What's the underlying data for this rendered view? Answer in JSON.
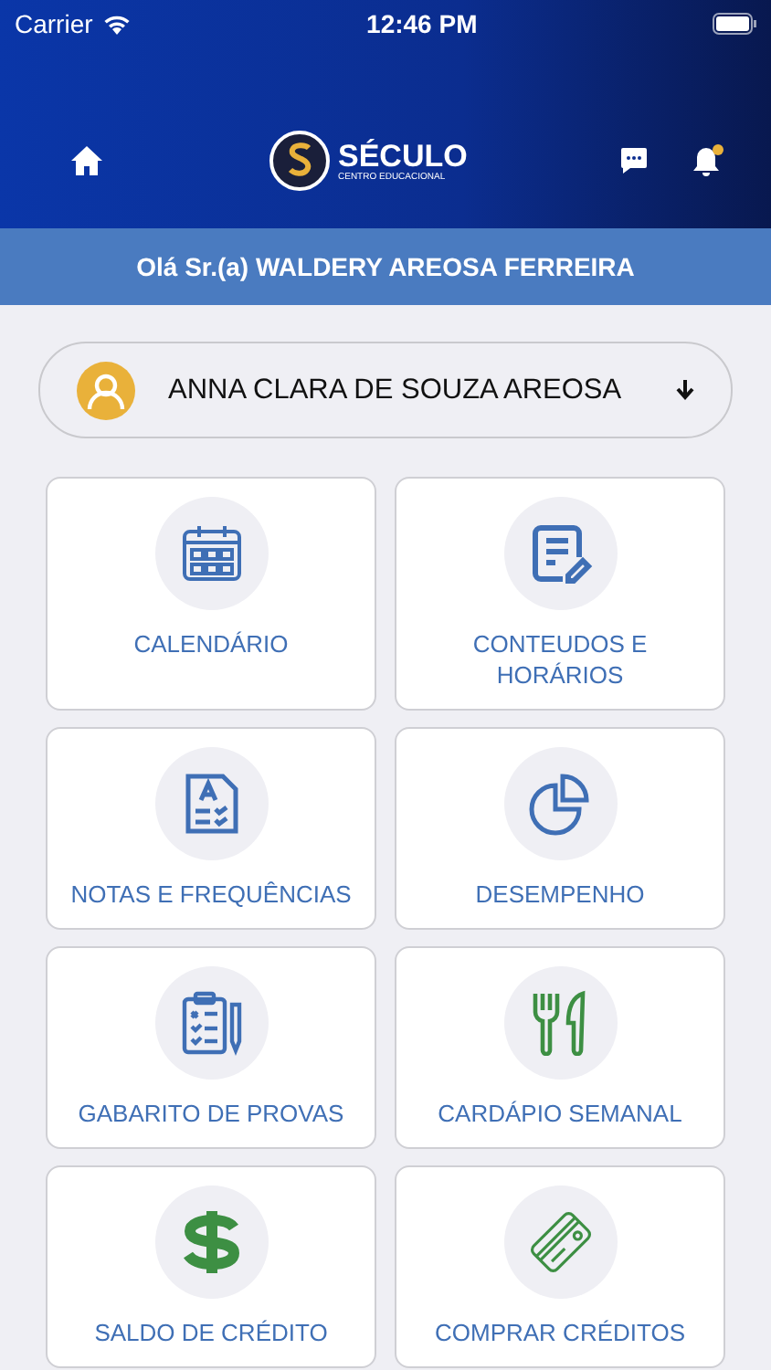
{
  "status_bar": {
    "carrier": "Carrier",
    "time": "12:46 PM"
  },
  "header": {
    "logo_title": "SÉCULO",
    "logo_subtitle": "CENTRO EDUCACIONAL",
    "notification_badge": true
  },
  "greeting": "Olá Sr.(a) WALDERY AREOSA FERREIRA",
  "student_selector": {
    "value": "ANNA CLARA DE SOUZA AREOSA"
  },
  "menu": [
    {
      "kind": "calendar",
      "label": "CALENDÁRIO"
    },
    {
      "kind": "document",
      "label": "CONTEUDOS E HORÁRIOS"
    },
    {
      "kind": "grades",
      "label": "NOTAS E FREQUÊNCIAS"
    },
    {
      "kind": "chart",
      "label": "DESEMPENHO"
    },
    {
      "kind": "clipboard",
      "label": "GABARITO DE PROVAS"
    },
    {
      "kind": "cutlery",
      "label": "CARDÁPIO SEMANAL"
    },
    {
      "kind": "dollar",
      "label": "SALDO DE CRÉDITO"
    },
    {
      "kind": "card",
      "label": "COMPRAR CRÉDITOS"
    }
  ]
}
